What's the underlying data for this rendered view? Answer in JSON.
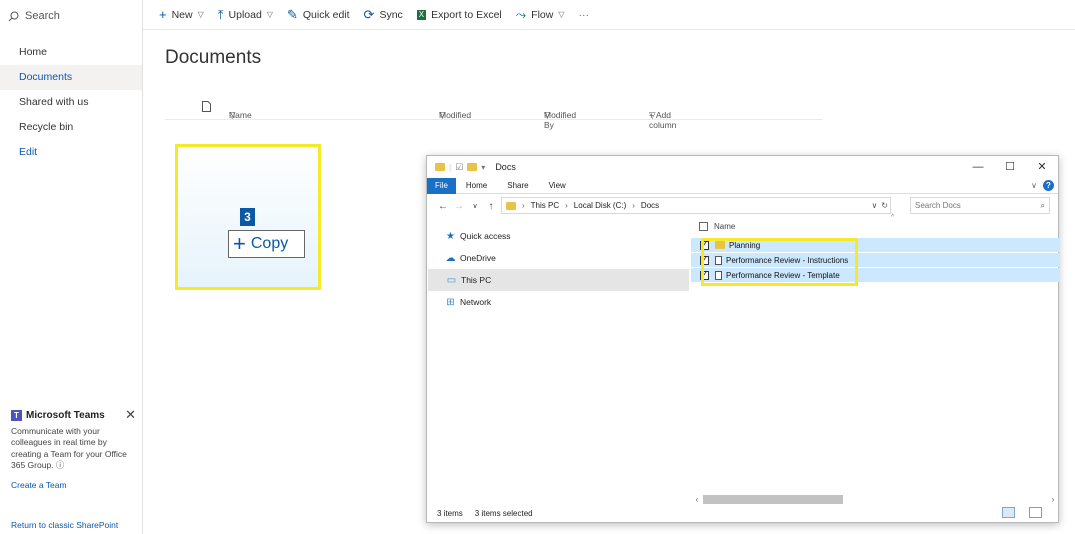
{
  "leftnav": {
    "search_label": "Search",
    "items": [
      {
        "label": "Home"
      },
      {
        "label": "Documents"
      },
      {
        "label": "Shared with us"
      },
      {
        "label": "Recycle bin"
      },
      {
        "label": "Edit"
      }
    ],
    "teams": {
      "title": "Microsoft Teams",
      "desc_1": "Communicate with your",
      "desc_2": "colleagues in real time by",
      "desc_3": "creating a Team for your Office",
      "desc_4": "365 Group.",
      "create": "Create a Team",
      "close": "✕"
    },
    "classic": "Return to classic SharePoint"
  },
  "cmdbar": {
    "new": "New",
    "upload": "Upload",
    "quick_edit": "Quick edit",
    "sync": "Sync",
    "export": "Export to Excel",
    "flow": "Flow",
    "more": "···"
  },
  "page_title": "Documents",
  "columns": {
    "name": "Name",
    "modified": "Modified",
    "modified_by": "Modified By",
    "add_column": "+ Add column"
  },
  "drop": {
    "count": "3",
    "copy_label": "Copy"
  },
  "explorer": {
    "title": "Docs",
    "ribbon": {
      "file": "File",
      "home": "Home",
      "share": "Share",
      "view": "View"
    },
    "address": {
      "c1": "This PC",
      "c2": "Local Disk (C:)",
      "c3": "Docs"
    },
    "search_placeholder": "Search Docs",
    "nav": [
      {
        "label": "Quick access"
      },
      {
        "label": "OneDrive"
      },
      {
        "label": "This PC"
      },
      {
        "label": "Network"
      }
    ],
    "name_header": "Name",
    "files": [
      {
        "name": "Planning"
      },
      {
        "name": "Performance Review - Instructions"
      },
      {
        "name": "Performance Review - Template"
      }
    ],
    "status": {
      "items": "3 items",
      "selected": "3 items selected"
    }
  }
}
